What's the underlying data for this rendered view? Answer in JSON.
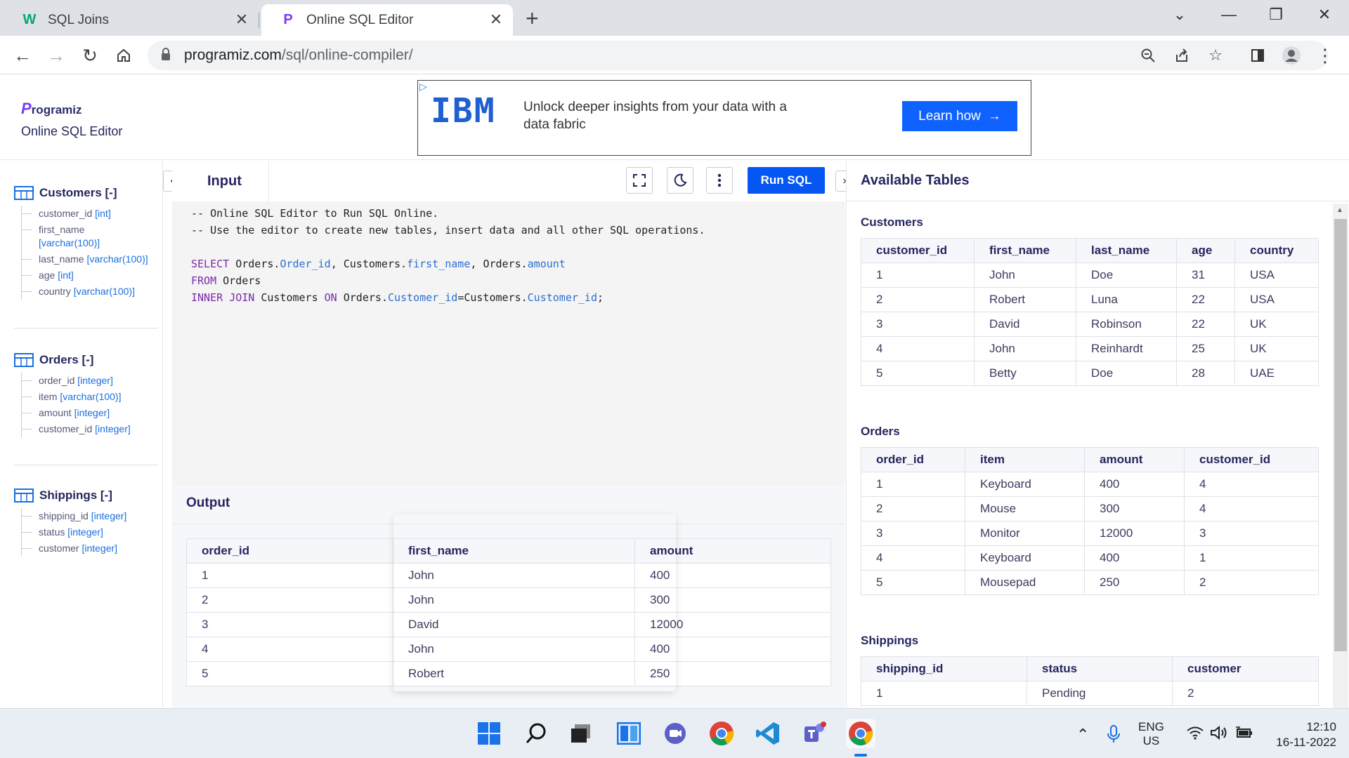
{
  "browser": {
    "tabs": [
      {
        "title": "SQL Joins",
        "favicon": "W"
      },
      {
        "title": "Online SQL Editor",
        "favicon": "P"
      }
    ],
    "url_host": "programiz.com",
    "url_path": "/sql/online-compiler/"
  },
  "site": {
    "logo_text": "rogramiz",
    "logo_mark": "P",
    "subtitle": "Online SQL Editor"
  },
  "ad": {
    "brand": "IBM",
    "text": "Unlock deeper insights from your data with a data fabric",
    "button": "Learn how"
  },
  "schema": [
    {
      "name": "Customers [-]",
      "columns": [
        {
          "name": "customer_id",
          "type": "[int]"
        },
        {
          "name": "first_name",
          "type": "[varchar(100)]"
        },
        {
          "name": "last_name",
          "type": "[varchar(100)]"
        },
        {
          "name": "age",
          "type": "[int]"
        },
        {
          "name": "country",
          "type": "[varchar(100)]"
        }
      ]
    },
    {
      "name": "Orders [-]",
      "columns": [
        {
          "name": "order_id",
          "type": "[integer]"
        },
        {
          "name": "item",
          "type": "[varchar(100)]"
        },
        {
          "name": "amount",
          "type": "[integer]"
        },
        {
          "name": "customer_id",
          "type": "[integer]"
        }
      ]
    },
    {
      "name": "Shippings [-]",
      "columns": [
        {
          "name": "shipping_id",
          "type": "[integer]"
        },
        {
          "name": "status",
          "type": "[integer]"
        },
        {
          "name": "customer",
          "type": "[integer]"
        }
      ]
    }
  ],
  "editor": {
    "input_label": "Input",
    "run_label": "Run SQL",
    "code": [
      {
        "text": "-- Online SQL Editor to Run SQL Online."
      },
      {
        "text": "-- Use the editor to create new tables, insert data and all other SQL operations."
      },
      {
        "text": ""
      },
      {
        "text": "SELECT Orders.Order_id, Customers.first_name, Orders.amount"
      },
      {
        "text": "FROM Orders"
      },
      {
        "text": "INNER JOIN Customers ON Orders.Customer_id=Customers.Customer_id;"
      }
    ]
  },
  "output": {
    "label": "Output",
    "headers": [
      "order_id",
      "first_name",
      "amount"
    ],
    "rows": [
      [
        "1",
        "John",
        "400"
      ],
      [
        "2",
        "John",
        "300"
      ],
      [
        "3",
        "David",
        "12000"
      ],
      [
        "4",
        "John",
        "400"
      ],
      [
        "5",
        "Robert",
        "250"
      ]
    ]
  },
  "available": {
    "title": "Available Tables",
    "tables": [
      {
        "name": "Customers",
        "headers": [
          "customer_id",
          "first_name",
          "last_name",
          "age",
          "country"
        ],
        "rows": [
          [
            "1",
            "John",
            "Doe",
            "31",
            "USA"
          ],
          [
            "2",
            "Robert",
            "Luna",
            "22",
            "USA"
          ],
          [
            "3",
            "David",
            "Robinson",
            "22",
            "UK"
          ],
          [
            "4",
            "John",
            "Reinhardt",
            "25",
            "UK"
          ],
          [
            "5",
            "Betty",
            "Doe",
            "28",
            "UAE"
          ]
        ]
      },
      {
        "name": "Orders",
        "headers": [
          "order_id",
          "item",
          "amount",
          "customer_id"
        ],
        "rows": [
          [
            "1",
            "Keyboard",
            "400",
            "4"
          ],
          [
            "2",
            "Mouse",
            "300",
            "4"
          ],
          [
            "3",
            "Monitor",
            "12000",
            "3"
          ],
          [
            "4",
            "Keyboard",
            "400",
            "1"
          ],
          [
            "5",
            "Mousepad",
            "250",
            "2"
          ]
        ]
      },
      {
        "name": "Shippings",
        "headers": [
          "shipping_id",
          "status",
          "customer"
        ],
        "rows": [
          [
            "1",
            "Pending",
            "2"
          ]
        ]
      }
    ]
  },
  "taskbar": {
    "lang_top": "ENG",
    "lang_bottom": "US",
    "time": "12:10",
    "date": "16-11-2022"
  },
  "colors": {
    "accent": "#0556f3",
    "brand": "#7a3cf5",
    "type_blue": "#1a6fe0",
    "comment": "#b8651b",
    "keyword": "#7a2aa8"
  }
}
